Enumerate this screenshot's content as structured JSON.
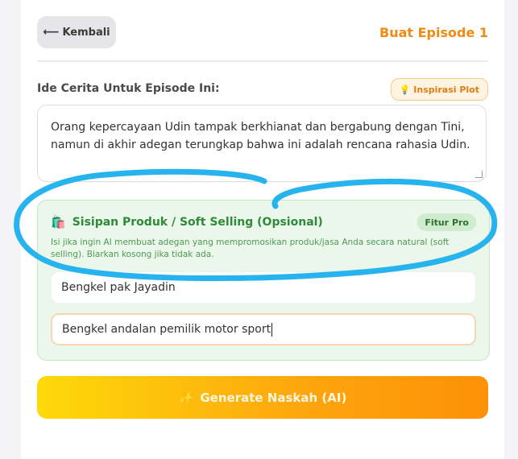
{
  "header": {
    "back_label": "Kembali",
    "title": "Buat Episode 1"
  },
  "story_idea": {
    "label": "Ide Cerita Untuk Episode Ini:",
    "inspiration_label": "Inspirasi Plot",
    "text": "Orang kepercayaan Udin tampak berkhianat dan bergabung dengan Tini, namun di akhir adegan terungkap bahwa ini adalah rencana rahasia Udin."
  },
  "product_placement": {
    "title": "Sisipan Produk / Soft Selling (Opsional)",
    "badge": "Fitur Pro",
    "description": "Isi jika ingin AI membuat adegan yang mempromosikan produk/jasa Anda secara natural (soft selling). Biarkan kosong jika tidak ada.",
    "product_name_value": "Bengkel pak Jayadin",
    "product_desc_value": "Bengkel andalan pemilik motor sport"
  },
  "generate": {
    "label": "Generate Naskah (AI)"
  },
  "colors": {
    "accent_orange": "#f08a12",
    "annotation_blue": "#27b4ee",
    "green_title": "#2f8a3a"
  },
  "icons": {
    "back": "arrow-left-icon",
    "inspiration": "lightbulb-icon",
    "product": "shopping-bag-icon",
    "generate": "sparkles-icon"
  }
}
